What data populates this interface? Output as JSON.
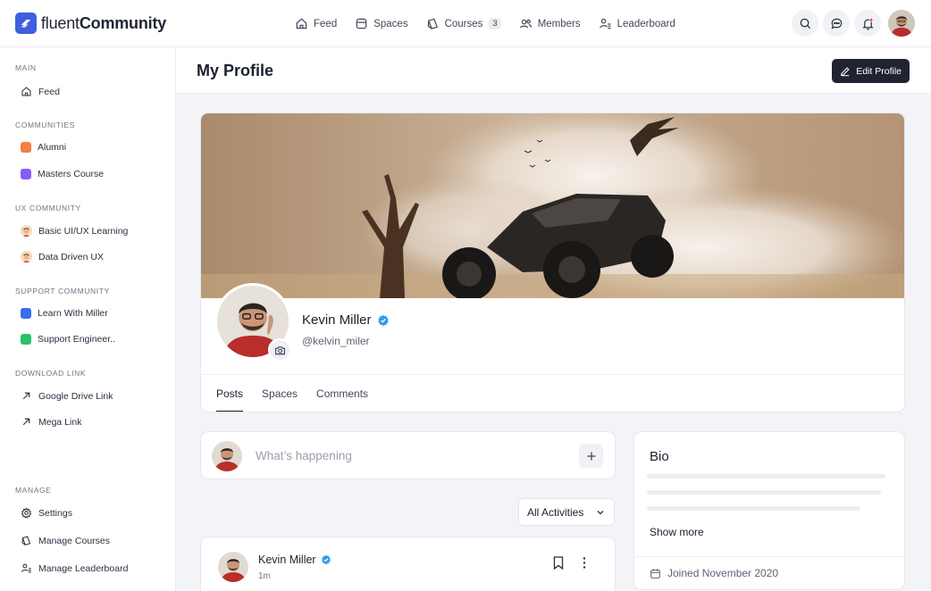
{
  "brand": {
    "name_light": "fluent",
    "name_bold": "Community",
    "accent": "#3f5fe0"
  },
  "topnav": [
    {
      "label": "Feed",
      "icon": "home-icon"
    },
    {
      "label": "Spaces",
      "icon": "spaces-icon"
    },
    {
      "label": "Courses",
      "icon": "courses-icon",
      "badge": "3"
    },
    {
      "label": "Members",
      "icon": "members-icon"
    },
    {
      "label": "Leaderboard",
      "icon": "leaderboard-icon"
    }
  ],
  "sidebar": {
    "sections": [
      {
        "heading": "MAIN",
        "items": [
          {
            "label": "Feed",
            "icon": "home-icon"
          }
        ]
      },
      {
        "heading": "COMMUNITIES",
        "items": [
          {
            "label": "Alumni",
            "icon": "square-icon",
            "color": "#f47f42"
          },
          {
            "label": "Masters Course",
            "icon": "square-icon",
            "color": "#8a5cf5"
          }
        ]
      },
      {
        "heading": "UX COMMUNITY",
        "items": [
          {
            "label": "Basic UI/UX Learning",
            "icon": "person-emoji-icon"
          },
          {
            "label": "Data Driven UX",
            "icon": "person-emoji-icon"
          }
        ]
      },
      {
        "heading": "SUPPORT COMMUNITY",
        "items": [
          {
            "label": "Learn With Miller",
            "icon": "square-icon",
            "color": "#3b6cf2"
          },
          {
            "label": "Support Engineer..",
            "icon": "square-icon",
            "color": "#27c46b"
          }
        ]
      },
      {
        "heading": "DOWNLOAD LINK",
        "items": [
          {
            "label": "Google Drive Link",
            "icon": "arrow-up-right-icon"
          },
          {
            "label": "Mega Link",
            "icon": "arrow-up-right-icon"
          }
        ]
      },
      {
        "heading": "MANAGE",
        "items": [
          {
            "label": "Settings",
            "icon": "gear-icon"
          },
          {
            "label": "Manage Courses",
            "icon": "courses-icon"
          },
          {
            "label": "Manage Leaderboard",
            "icon": "leaderboard-icon"
          }
        ]
      }
    ]
  },
  "page": {
    "title": "My Profile",
    "edit_label": "Edit Profile"
  },
  "profile": {
    "name": "Kevin Miller",
    "handle": "@kelvin_miler",
    "verified_color": "#2f9df2",
    "tabs": [
      "Posts",
      "Spaces",
      "Comments"
    ],
    "active_tab": "Posts"
  },
  "composer": {
    "placeholder": "What’s happening"
  },
  "filter": {
    "selected": "All Activities"
  },
  "post": {
    "author": "Kevin Miller",
    "time": "1m"
  },
  "bio": {
    "title": "Bio",
    "show_more": "Show more",
    "joined": "Joined November 2020"
  }
}
